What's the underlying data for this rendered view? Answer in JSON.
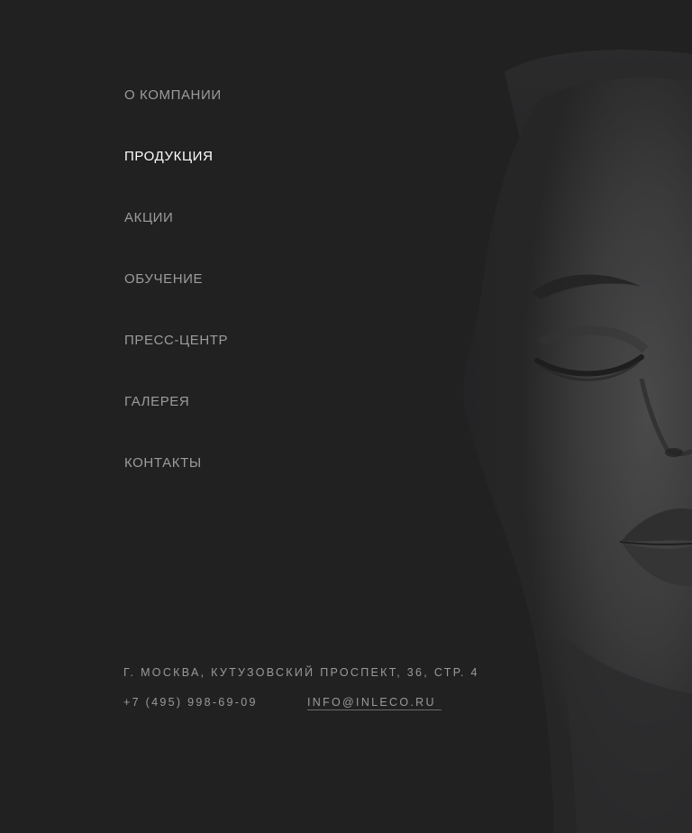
{
  "nav": {
    "items": [
      {
        "label": "О КОМПАНИИ",
        "active": false
      },
      {
        "label": "ПРОДУКЦИЯ",
        "active": true
      },
      {
        "label": "АКЦИИ",
        "active": false
      },
      {
        "label": "ОБУЧЕНИЕ",
        "active": false
      },
      {
        "label": "ПРЕСС-ЦЕНТР",
        "active": false
      },
      {
        "label": "ГАЛЕРЕЯ",
        "active": false
      },
      {
        "label": "КОНТАКТЫ",
        "active": false
      }
    ]
  },
  "contacts": {
    "address": "Г. МОСКВА, КУТУЗОВСКИЙ ПРОСПЕКТ, 36, СТР. 4",
    "phone": "+7 (495) 998-69-09",
    "email": "INFO@INLECO.RU"
  },
  "colors": {
    "background": "#212122",
    "nav_text": "#9c9c9e",
    "nav_active": "#ffffff",
    "contact_text": "#9a9a9c"
  },
  "images": {
    "background_portrait": "woman-face-portrait-image"
  }
}
